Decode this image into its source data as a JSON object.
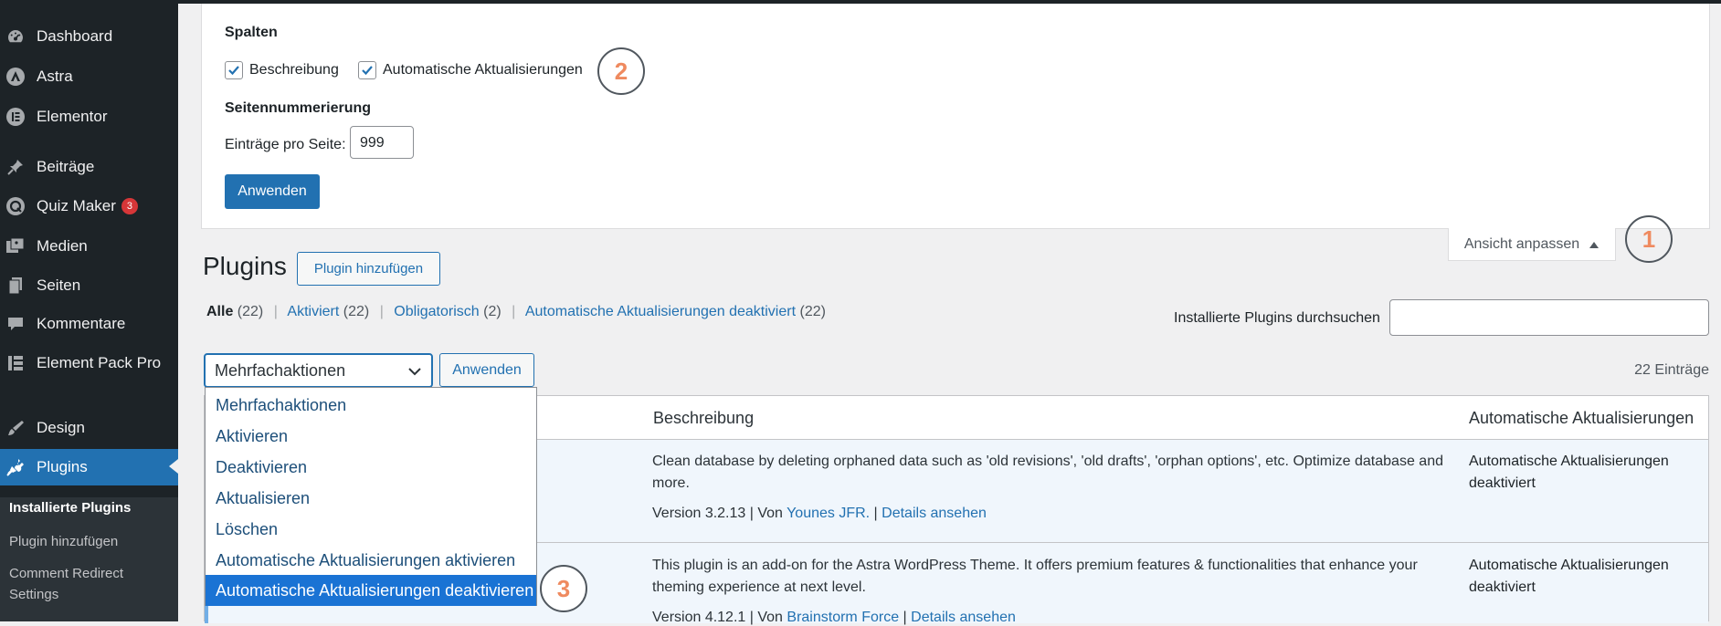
{
  "sidebar": {
    "items": [
      {
        "label": "Dashboard",
        "icon": "dashboard-icon"
      },
      {
        "label": "Astra",
        "icon": "astra-icon"
      },
      {
        "label": "Elementor",
        "icon": "elementor-icon"
      },
      {
        "label": "Beiträge",
        "icon": "pin-icon"
      },
      {
        "label": "Quiz Maker",
        "icon": "quiz-icon",
        "badge": "3"
      },
      {
        "label": "Medien",
        "icon": "media-icon"
      },
      {
        "label": "Seiten",
        "icon": "pages-icon"
      },
      {
        "label": "Kommentare",
        "icon": "comments-icon"
      },
      {
        "label": "Element Pack Pro",
        "icon": "element-pack-icon"
      },
      {
        "label": "Design",
        "icon": "brush-icon"
      },
      {
        "label": "Plugins",
        "icon": "plugin-icon"
      }
    ],
    "submenu": [
      "Installierte Plugins",
      "Plugin hinzufügen",
      "Comment Redirect Settings"
    ]
  },
  "screen_options": {
    "columns_heading": "Spalten",
    "checkboxes": [
      {
        "label": "Beschreibung",
        "checked": true
      },
      {
        "label": "Automatische Aktualisierungen",
        "checked": true
      }
    ],
    "pagination_heading": "Seitennummerierung",
    "per_page_label": "Einträge pro Seite:",
    "per_page_value": "999",
    "apply_label": "Anwenden",
    "toggle_label": "Ansicht anpassen"
  },
  "callouts": [
    "1",
    "2",
    "3"
  ],
  "page": {
    "title": "Plugins",
    "add_new_label": "Plugin hinzufügen"
  },
  "filters": {
    "all": "Alle",
    "all_count": "(22)",
    "active": "Aktiviert",
    "active_count": "(22)",
    "mustuse": "Obligatorisch",
    "mustuse_count": "(2)",
    "autodisabled": "Automatische Aktualisierungen deaktiviert",
    "autodisabled_count": "(22)",
    "separator": "|"
  },
  "search": {
    "label": "Installierte Plugins durchsuchen"
  },
  "bulk": {
    "selected": "Mehrfachaktionen",
    "apply_label": "Anwenden",
    "options": [
      "Mehrfachaktionen",
      "Aktivieren",
      "Deaktivieren",
      "Aktualisieren",
      "Löschen",
      "Automatische Aktualisierungen aktivieren",
      "Automatische Aktualisierungen deaktivieren"
    ],
    "highlighted_index": 6
  },
  "count": "22 Einträge",
  "table": {
    "headers": [
      "Beschreibung",
      "Automatische Aktualisierungen"
    ],
    "rows": [
      {
        "description": "Clean database by deleting orphaned data such as 'old revisions', 'old drafts', 'orphan options', etc. Optimize database and more.",
        "version": "Version 3.2.13",
        "by": "Von",
        "author": "Younes JFR.",
        "details": "Details ansehen",
        "auto_line1": "Automatische Aktualisierungen",
        "auto_line2": "deaktiviert"
      },
      {
        "description": "This plugin is an add-on for the Astra WordPress Theme. It offers premium features & functionalities that enhance your theming experience at next level.",
        "version": "Version 4.12.1",
        "by": "Von",
        "author": "Brainstorm Force",
        "details": "Details ansehen",
        "auto_line1": "Automatische Aktualisierungen",
        "auto_line2": "deaktiviert"
      }
    ]
  },
  "colors": {
    "admin_bg": "#1d2327",
    "accent": "#2271b1",
    "callout_number": "#ef8a5f",
    "badge": "#d63638"
  }
}
